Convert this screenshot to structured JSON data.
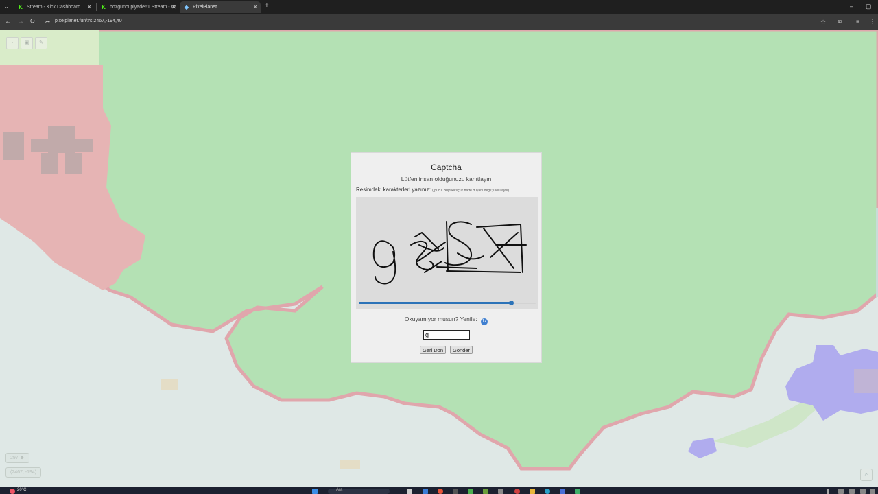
{
  "browser": {
    "tabs": [
      {
        "title": "Stream - Kick Dashboard",
        "favicon": "kick-icon",
        "active": false
      },
      {
        "title": "bozguncupiyade61 Stream - W",
        "favicon": "kick-icon",
        "active": false
      },
      {
        "title": "PixelPlanet",
        "favicon": "pixelplanet-icon",
        "active": true
      }
    ],
    "new_tab": "+",
    "url": "pixelplanet.fun/#s,2467,-194,40"
  },
  "canvas": {
    "online_count": "297",
    "coordinates": "(2467, -194)"
  },
  "captcha": {
    "title": "Captcha",
    "subtitle": "Lütfen insan olduğunuzu kanıtlayın",
    "instruction": "Resimdeki karakterleri yazınız:",
    "hint": "(İpucu: Büyük/küçük harfe duyarlı değil; I ve l aynı)",
    "slider_fraction": 0.86,
    "refresh_text": "Okuyamıyor musun? Yenile:",
    "answer_value": "g",
    "back_label": "Geri Dön",
    "submit_label": "Gönder"
  },
  "taskbar": {
    "weather": "20°C",
    "search_placeholder": "Ara"
  },
  "colors": {
    "accent": "#2c73b8",
    "land": "#b4e1b4",
    "water": "#dfe8e6",
    "red_region": "#e6b4b4",
    "border": "#e0a6ac",
    "purple_region": "#b0acee"
  }
}
